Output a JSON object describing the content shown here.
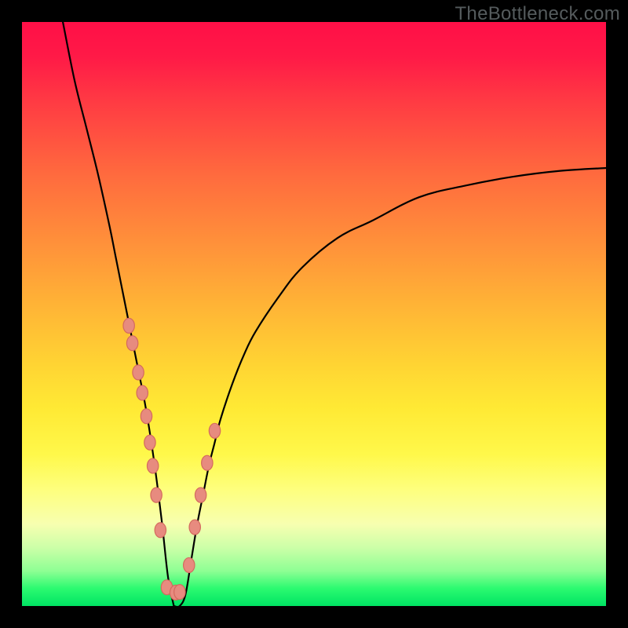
{
  "watermark": "TheBottleneck.com",
  "colors": {
    "frame": "#000000",
    "curve": "#000000",
    "marker_fill": "#e78b7f",
    "marker_stroke": "#d46a5e",
    "gradient_top": "#ff0f47",
    "gradient_bottom": "#00e463"
  },
  "chart_data": {
    "type": "line",
    "title": "",
    "xlabel": "",
    "ylabel": "",
    "xlim": [
      0,
      100
    ],
    "ylim": [
      0,
      100
    ],
    "grid": false,
    "legend": false,
    "description": "V-shaped bottleneck curve with a single minimum near x≈26 reaching y≈0; left branch starts near (7,100) and right branch reaches about (100,75). Background gradient encodes severity from red (top, high mismatch) to green (bottom, balanced).",
    "series": [
      {
        "name": "curve",
        "x": [
          7,
          9,
          11,
          13,
          15,
          16,
          17,
          18,
          19,
          20,
          21,
          22,
          23,
          24,
          25,
          26,
          27,
          28,
          29,
          30,
          31,
          32,
          33,
          34,
          36,
          38,
          40,
          44,
          48,
          54,
          60,
          68,
          76,
          84,
          92,
          100
        ],
        "y": [
          100,
          90,
          82,
          74,
          65,
          60,
          55,
          50,
          45,
          40,
          35,
          29,
          22,
          14,
          5,
          0,
          0,
          2,
          8,
          14,
          19,
          24,
          28,
          32,
          38,
          43,
          47,
          53,
          58,
          63,
          66,
          70,
          72,
          73.5,
          74.5,
          75
        ]
      }
    ],
    "markers": {
      "name": "highlighted-points",
      "x": [
        18.3,
        18.9,
        19.9,
        20.6,
        21.3,
        21.9,
        22.4,
        23.0,
        23.7,
        24.8,
        26.3,
        27.0,
        28.6,
        29.6,
        30.6,
        31.7,
        33.0
      ],
      "y": [
        48.0,
        45.0,
        40.0,
        36.5,
        32.5,
        28.0,
        24.0,
        19.0,
        13.0,
        3.2,
        2.3,
        2.4,
        7.0,
        13.5,
        19.0,
        24.5,
        30.0
      ]
    }
  }
}
